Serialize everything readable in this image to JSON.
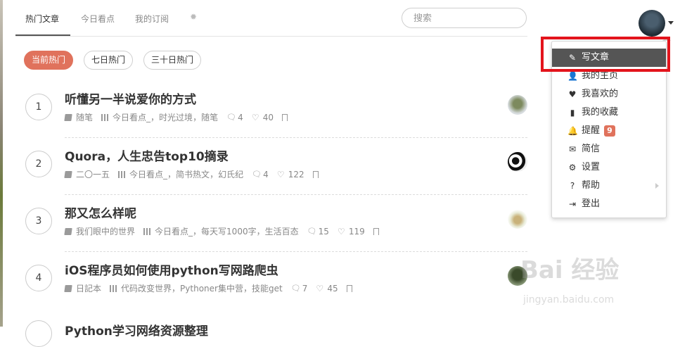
{
  "tabs": [
    {
      "label": "热门文章",
      "active": true
    },
    {
      "label": "今日看点",
      "active": false
    },
    {
      "label": "我的订阅",
      "active": false
    }
  ],
  "search": {
    "placeholder": "搜索"
  },
  "filters": [
    {
      "label": "当前热门",
      "active": true
    },
    {
      "label": "七日热门",
      "active": false
    },
    {
      "label": "三十日热门",
      "active": false
    }
  ],
  "articles": [
    {
      "rank": "1",
      "title": "听懂另一半说爱你的方式",
      "notebook": "随笔",
      "collections": [
        "今日看点_",
        "时光过境",
        "随笔"
      ],
      "comments": "4",
      "likes": "40"
    },
    {
      "rank": "2",
      "title": "Quora，人生忠告top10摘录",
      "notebook": "二〇一五",
      "collections": [
        "今日看点_",
        "简书热文",
        "幻氏纪"
      ],
      "comments": "4",
      "likes": "122"
    },
    {
      "rank": "3",
      "title": "那又怎么样呢",
      "notebook": "我们眼中的世界",
      "collections": [
        "今日看点_",
        "每天写1000字",
        "生活百态"
      ],
      "comments": "15",
      "likes": "119"
    },
    {
      "rank": "4",
      "title": "iOS程序员如何使用python写网路爬虫",
      "notebook": "日記本",
      "collections": [
        "代码改变世界",
        "Pythoner集中营",
        "技能get"
      ],
      "comments": "7",
      "likes": "45"
    }
  ],
  "partial_article_title": "Python学习网络资源整理",
  "menu": {
    "write": "写文章",
    "items": [
      {
        "label": "我的主页",
        "icon": "user-icon"
      },
      {
        "label": "我喜欢的",
        "icon": "heart-icon"
      },
      {
        "label": "我的收藏",
        "icon": "bookmark-icon"
      },
      {
        "label": "提醒",
        "icon": "bell-icon",
        "badge": "9"
      },
      {
        "label": "简信",
        "icon": "envelope-icon"
      },
      {
        "label": "设置",
        "icon": "gears-icon"
      },
      {
        "label": "帮助",
        "icon": "question-icon"
      },
      {
        "label": "登出",
        "icon": "logout-icon"
      }
    ]
  },
  "watermark": {
    "brand": "Bai 经验",
    "url": "jingyan.baidu.com"
  },
  "colors": {
    "accent": "#e0725c",
    "highlight": "#e3141c",
    "menu_active": "#555555"
  }
}
